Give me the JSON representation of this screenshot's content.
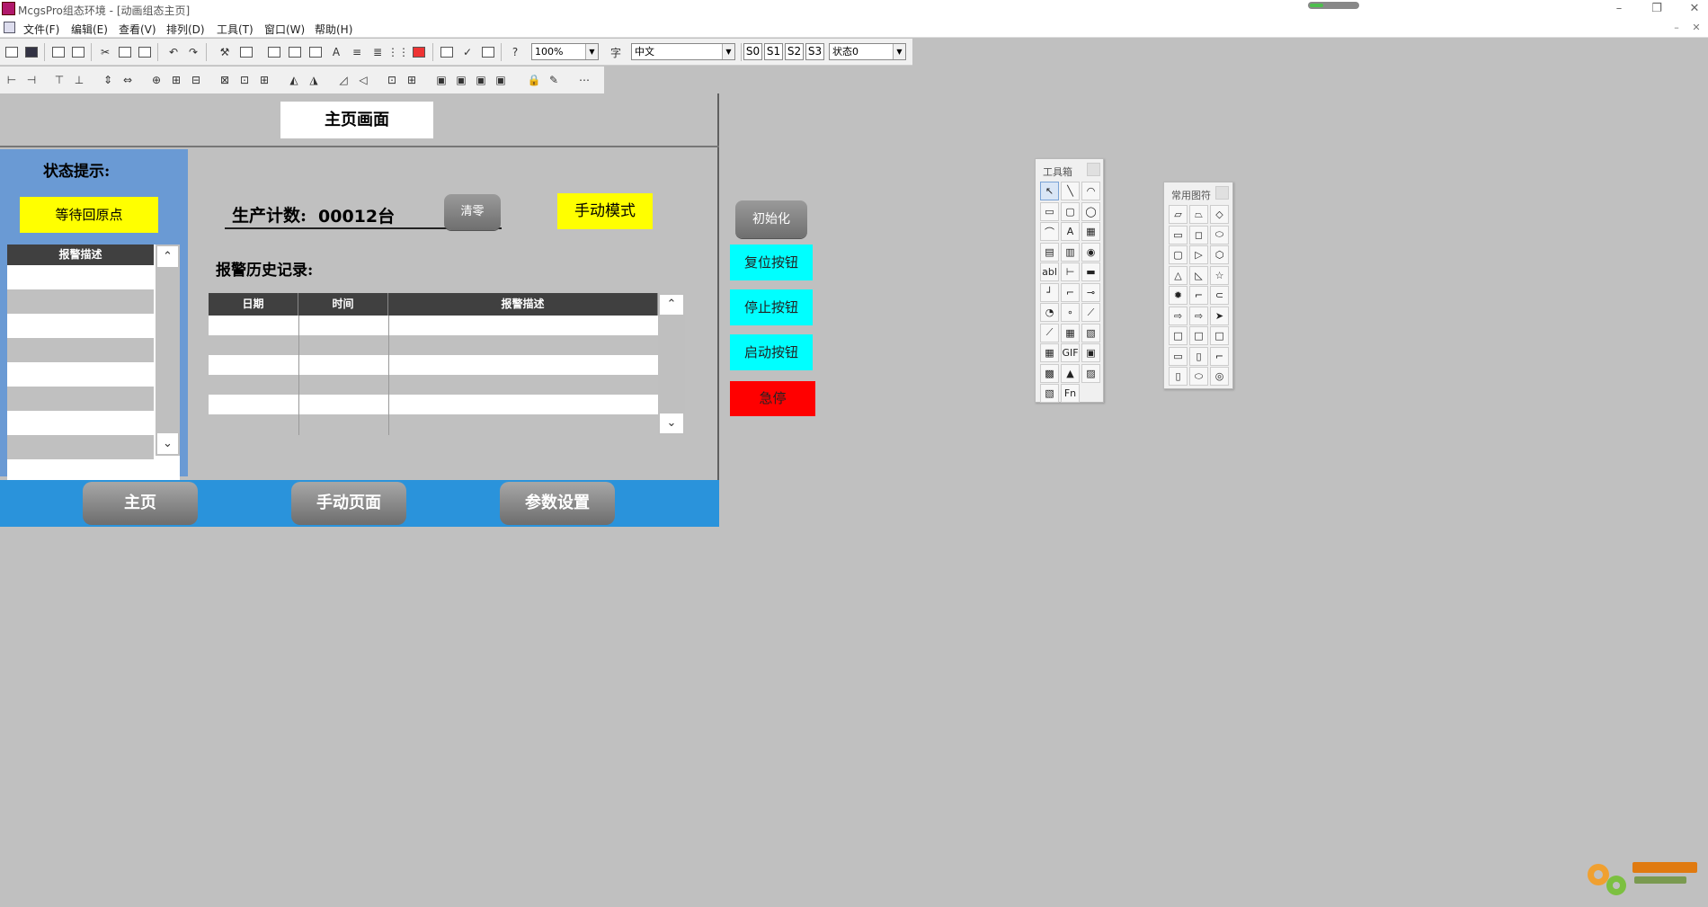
{
  "window": {
    "title": "McgsPro组态环境 - [动画组态主页]",
    "controls": [
      "–",
      "❐",
      "✕"
    ],
    "mdi_controls": [
      "–",
      "❐",
      "✕"
    ]
  },
  "menu": [
    "文件(F)",
    "编辑(E)",
    "查看(V)",
    "排列(D)",
    "工具(T)",
    "窗口(W)",
    "帮助(H)"
  ],
  "toolbar": {
    "zoom": "100%",
    "language": "中文",
    "states": [
      "S0",
      "S1",
      "S2",
      "S3"
    ],
    "state_select": "状态0"
  },
  "screen": {
    "title": "主页画面",
    "status_label": "状态提示:",
    "status_value": "等待回原点",
    "left_table_header": "报警描述",
    "count_label": "生产计数:",
    "count_value": "00012台",
    "clear_button": "清零",
    "mode": "手动模式",
    "history_label": "报警历史记录:",
    "history_columns": [
      "日期",
      "时间",
      "报警描述"
    ],
    "nav": [
      "主页",
      "手动页面",
      "参数设置"
    ]
  },
  "side_buttons": {
    "init": "初始化",
    "reset": "复位按钮",
    "stop": "停止按钮",
    "start": "启动按钮",
    "estop": "急停"
  },
  "toolbox": {
    "title": "工具箱",
    "tools": [
      "↖",
      "╲",
      "◠",
      "▭",
      "▢",
      "◯",
      "⌒",
      "A",
      "▦",
      "▤",
      "▥",
      "◉",
      "abl",
      "⊢",
      "▬",
      "┘",
      "⌐",
      "⊸",
      "◔",
      "∘",
      "⟋",
      "⟋",
      "▦",
      "▧",
      "▦",
      "GIF",
      "▣",
      "▩",
      "▲",
      "▨",
      "▧",
      "Fn"
    ]
  },
  "shapes": {
    "title": "常用图符",
    "shapes": [
      "▱",
      "⏢",
      "◇",
      "▭",
      "◻",
      "⬭",
      "▢",
      "▷",
      "⬡",
      "△",
      "◺",
      "☆",
      "✹",
      "⌐",
      "⊂",
      "⇨",
      "⇨",
      "➤",
      "□",
      "□",
      "□",
      "▭",
      "▯",
      "⌐",
      "▯",
      "⬭",
      "◎"
    ]
  },
  "colors": {
    "status_panel": "#6a9ad4",
    "nav_bar": "#2a93db",
    "yellow": "#ffff00",
    "cyan": "#00ffff",
    "red": "#ff0000"
  }
}
